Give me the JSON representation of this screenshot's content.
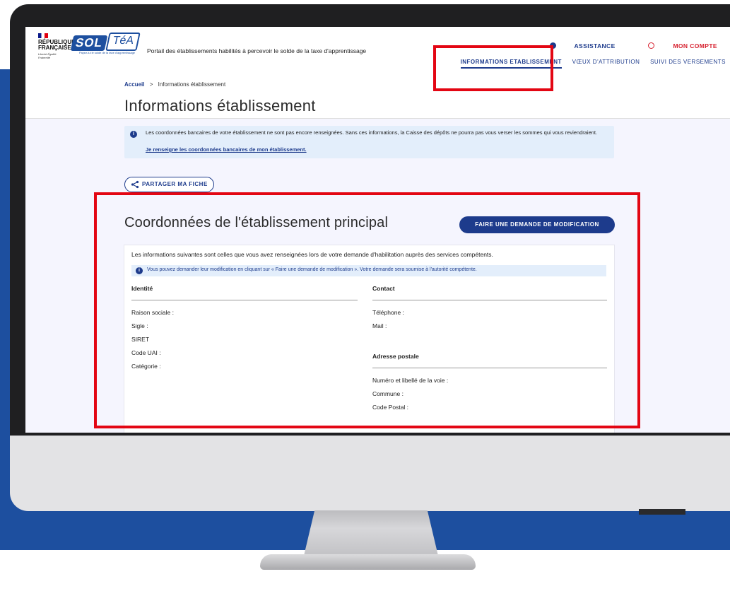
{
  "brand": {
    "republic": "RÉPUBLIQUE FRANÇAISE",
    "motto": "Liberté Égalité Fraternité",
    "logo_left": "SOL",
    "logo_right": "TéA",
    "logo_tagline": "Payez-lui le solde de la taxe d'apprentissage",
    "portal_title": "Portail des établissements habilités à percevoir le solde de la taxe d'apprentissage"
  },
  "top_links": {
    "assistance": "ASSISTANCE",
    "account": "MON COMPTE"
  },
  "nav": [
    {
      "label": "INFORMATIONS ETABLISSEMENT",
      "active": true
    },
    {
      "label": "VŒUX D'ATTRIBUTION",
      "active": false
    },
    {
      "label": "SUIVI DES VERSEMENTS",
      "active": false
    }
  ],
  "breadcrumb": {
    "home": "Accueil",
    "separator": ">",
    "current": "Informations établissement"
  },
  "page_title": "Informations établissement",
  "alert": {
    "text": "Les coordonnées bancaires de votre établissement ne sont pas encore renseignées. Sans ces informations, la Caisse des dépôts ne pourra pas vous verser les sommes qui vous reviendraient.",
    "link": "Je renseigne les coordonnées bancaires de mon établissement."
  },
  "share_button": "PARTAGER MA FICHE",
  "card": {
    "title": "Coordonnées de l'établissement principal",
    "modify_button": "FAIRE UNE DEMANDE DE MODIFICATION",
    "intro": "Les informations suivantes sont celles que vous avez renseignées lors de votre demande d'habilitation auprès des services compétents.",
    "note": "Vous pouvez demander leur modification en cliquant sur « Faire une demande de modification ». Votre demande sera soumise à l'autorité compétente.",
    "identity": {
      "heading": "Identité",
      "fields": [
        "Raison sociale :",
        "Sigle :",
        "SIRET",
        "Code UAI :",
        "Catégorie :"
      ]
    },
    "contact": {
      "heading": "Contact",
      "fields": [
        "Téléphone :",
        "Mail :"
      ]
    },
    "address": {
      "heading": "Adresse postale",
      "fields": [
        "Numéro et libellé de la voie :",
        "Commune :",
        "Code Postal :"
      ]
    }
  },
  "colors": {
    "brand_blue": "#1d3b8c",
    "background_blue": "#1d4f9f",
    "highlight_red": "#e30613",
    "account_red": "#d6202e"
  },
  "icons": [
    "question-circle-icon",
    "user-circle-icon",
    "info-icon",
    "share-icon"
  ]
}
